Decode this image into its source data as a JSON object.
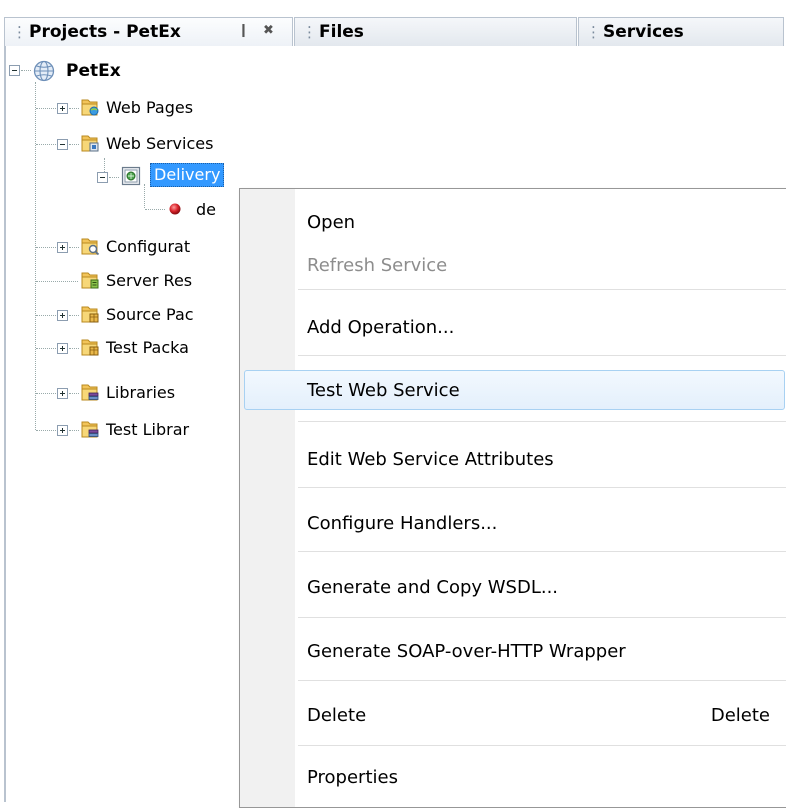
{
  "tabs": {
    "projects": "Projects - PetEx",
    "files": "Files",
    "services": "Services",
    "minimize_glyph": "❙",
    "close_glyph": "✖"
  },
  "tree": {
    "root": "PetEx",
    "web_pages": "Web Pages",
    "web_services": "Web Services",
    "delivery": "Delivery",
    "operation": "de",
    "configuration": "Configurat",
    "server_resources": "Server Res",
    "source_packages": "Source Pac",
    "test_packages": "Test Packa",
    "libraries": "Libraries",
    "test_libraries": "Test Librar"
  },
  "menu": {
    "open": "Open",
    "refresh_service": "Refresh Service",
    "add_operation": "Add Operation...",
    "test_web_service": "Test Web Service",
    "edit_attributes": "Edit Web Service Attributes",
    "configure_handlers": "Configure Handlers...",
    "generate_copy_wsdl": "Generate and Copy WSDL...",
    "generate_soap_wrapper": "Generate SOAP-over-HTTP Wrapper",
    "delete": "Delete",
    "delete_shortcut": "Delete",
    "properties": "Properties"
  },
  "colors": {
    "selection": "#3399ff",
    "folder": "#e9b84a",
    "hover_border": "#a8d1f2"
  }
}
